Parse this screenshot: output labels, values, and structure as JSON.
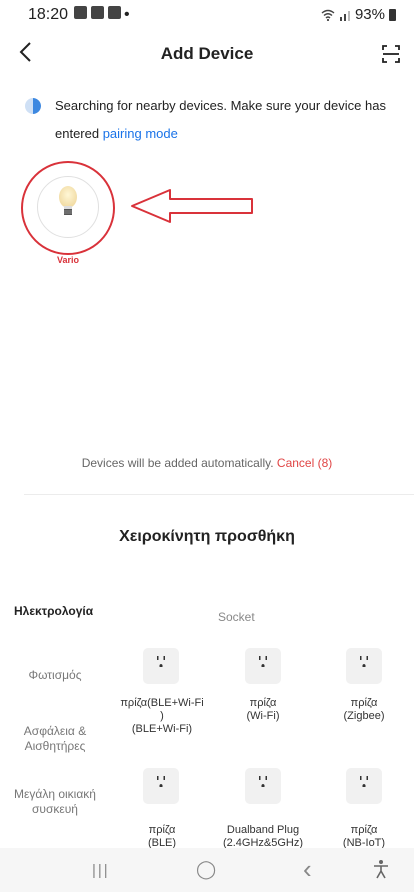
{
  "status_bar": {
    "time": "18:20",
    "extra": "•",
    "battery": "93%"
  },
  "header": {
    "title": "Add Device",
    "back_icon": "chevron-left-icon",
    "scan_icon": "scan-icon"
  },
  "search": {
    "text": "Searching for nearby devices. Make sure your device has entered ",
    "link": "pairing mode"
  },
  "found_device": {
    "name": "Vario",
    "annotation_color": "#d9323a"
  },
  "auto_add": {
    "text": "Devices will be added automatically. ",
    "cancel": "Cancel (8)"
  },
  "manual": {
    "title": "Χειροκίνητη προσθήκη"
  },
  "categories": [
    {
      "label": "Ηλεκτρολογία"
    },
    {
      "label": "Φωτισμός"
    },
    {
      "label": "Ασφάλεια & Αισθητήρες"
    },
    {
      "label": "Μεγάλη οικιακή συσκευή"
    }
  ],
  "section": {
    "heading": "Socket"
  },
  "products": [
    {
      "label": "πρίζα(BLE+Wi-Fi\n)\n(BLE+Wi-Fi)"
    },
    {
      "label": "πρίζα\n(Wi-Fi)"
    },
    {
      "label": "πρίζα\n(Zigbee)"
    },
    {
      "label": "πρίζα\n(BLE)"
    },
    {
      "label": "Dualband Plug\n(2.4GHz&5GHz)"
    },
    {
      "label": "πρίζα\n(NB-IoT)"
    }
  ],
  "nav": {
    "recent": "|||",
    "home": "◯",
    "back": "‹",
    "accessibility": "⚲"
  },
  "colors": {
    "accent": "#1a73e8",
    "danger": "#e04545"
  }
}
